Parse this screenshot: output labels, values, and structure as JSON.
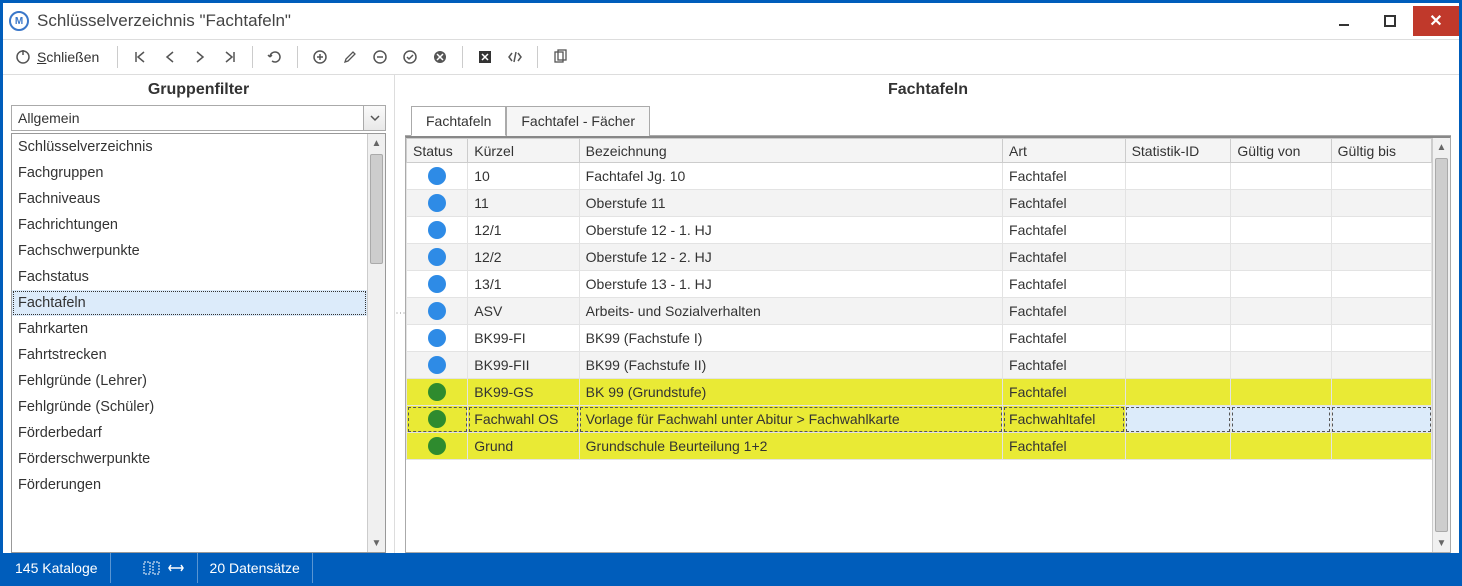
{
  "window": {
    "title": "Schlüsselverzeichnis \"Fachtafeln\""
  },
  "toolbar": {
    "close_label": "Schließen"
  },
  "left": {
    "header": "Gruppenfilter",
    "combo_value": "Allgemein",
    "items": [
      "Schlüsselverzeichnis",
      "Fachgruppen",
      "Fachniveaus",
      "Fachrichtungen",
      "Fachschwerpunkte",
      "Fachstatus",
      "Fachtafeln",
      "Fahrkarten",
      "Fahrtstrecken",
      "Fehlgründe (Lehrer)",
      "Fehlgründe (Schüler)",
      "Förderbedarf",
      "Förderschwerpunkte",
      "Förderungen"
    ],
    "selected_index": 6
  },
  "right": {
    "header": "Fachtafeln",
    "tabs": [
      "Fachtafeln",
      "Fachtafel - Fächer"
    ],
    "active_tab": 0,
    "columns": [
      "Status",
      "Kürzel",
      "Bezeichnung",
      "Art",
      "Statistik-ID",
      "Gültig von",
      "Gültig bis"
    ],
    "rows": [
      {
        "status": "blue",
        "kuerzel": "10",
        "bezeichnung": "Fachtafel Jg. 10",
        "art": "Fachtafel",
        "statid": "",
        "von": "",
        "bis": "",
        "hl": false,
        "sel": false
      },
      {
        "status": "blue",
        "kuerzel": "11",
        "bezeichnung": "Oberstufe 11",
        "art": "Fachtafel",
        "statid": "",
        "von": "",
        "bis": "",
        "hl": false,
        "sel": false
      },
      {
        "status": "blue",
        "kuerzel": "12/1",
        "bezeichnung": "Oberstufe 12 - 1. HJ",
        "art": "Fachtafel",
        "statid": "",
        "von": "",
        "bis": "",
        "hl": false,
        "sel": false
      },
      {
        "status": "blue",
        "kuerzel": "12/2",
        "bezeichnung": "Oberstufe 12 -  2. HJ",
        "art": "Fachtafel",
        "statid": "",
        "von": "",
        "bis": "",
        "hl": false,
        "sel": false
      },
      {
        "status": "blue",
        "kuerzel": "13/1",
        "bezeichnung": "Oberstufe 13 - 1. HJ",
        "art": "Fachtafel",
        "statid": "",
        "von": "",
        "bis": "",
        "hl": false,
        "sel": false
      },
      {
        "status": "blue",
        "kuerzel": "ASV",
        "bezeichnung": "Arbeits- und Sozialverhalten",
        "art": "Fachtafel",
        "statid": "",
        "von": "",
        "bis": "",
        "hl": false,
        "sel": false
      },
      {
        "status": "blue",
        "kuerzel": "BK99-FI",
        "bezeichnung": "BK99 (Fachstufe I)",
        "art": "Fachtafel",
        "statid": "",
        "von": "",
        "bis": "",
        "hl": false,
        "sel": false
      },
      {
        "status": "blue",
        "kuerzel": "BK99-FII",
        "bezeichnung": "BK99 (Fachstufe II)",
        "art": "Fachtafel",
        "statid": "",
        "von": "",
        "bis": "",
        "hl": false,
        "sel": false
      },
      {
        "status": "green",
        "kuerzel": "BK99-GS",
        "bezeichnung": "BK 99 (Grundstufe)",
        "art": "Fachtafel",
        "statid": "",
        "von": "",
        "bis": "",
        "hl": true,
        "sel": false
      },
      {
        "status": "green",
        "kuerzel": "Fachwahl OS",
        "bezeichnung": "Vorlage für Fachwahl unter Abitur > Fachwahlkarte",
        "art": "Fachwahltafel",
        "statid": "",
        "von": "",
        "bis": "",
        "hl": true,
        "sel": true
      },
      {
        "status": "green",
        "kuerzel": "Grund",
        "bezeichnung": "Grundschule Beurteilung 1+2",
        "art": "Fachtafel",
        "statid": "",
        "von": "",
        "bis": "",
        "hl": true,
        "sel": false
      }
    ]
  },
  "statusbar": {
    "catalog_count": "145 Kataloge",
    "record_count": "20 Datensätze"
  }
}
